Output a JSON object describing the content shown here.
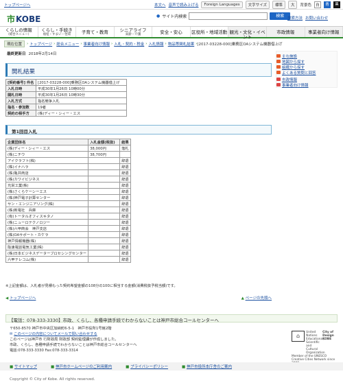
{
  "topbar": {
    "back": "トップページへ",
    "text_size": "本文へ",
    "voice": "音声で読み上げる",
    "foreign": "Foreign Languages",
    "fontsize": "文字サイズ",
    "standard": "標準",
    "large": "大",
    "bg": "背景色",
    "c1": "白",
    "c2": "青",
    "c3": "黒"
  },
  "header": {
    "logo": "KOBE",
    "search_label": "サイト内検索",
    "search_btn": "検索",
    "search_help": "検索方法",
    "inquiry": "お問い合わせ"
  },
  "nav": [
    {
      "label": "くらしの情報",
      "sub": "(総合メニュー)"
    },
    {
      "label": "くらし・手続き",
      "sub": "福祉・すまい・住環"
    },
    {
      "label": "子育て・教育",
      "sub": ""
    },
    {
      "label": "シニアライフ",
      "sub": "高齢・介護"
    },
    {
      "label": "安全・安心",
      "sub": ""
    },
    {
      "label": "区役所・地域活動",
      "sub": ""
    },
    {
      "label": "観光・文化・イベント",
      "sub": ""
    },
    {
      "label": "市政情報",
      "sub": ""
    },
    {
      "label": "事業者向け情報",
      "sub": ""
    }
  ],
  "crumb": {
    "current": "現在位置",
    "items": [
      "トップページ",
      "総合メニュー",
      "事業者向け情報",
      "入札・契約・税金",
      "入札情報",
      "物品等関札結果"
    ],
    "tail": "[2017-03228-000]乗務区OAシステム機器借上げ"
  },
  "updated": {
    "label": "最終更新日",
    "date": "2018年2月14日"
  },
  "side": [
    {
      "label": "主な施設",
      "icon": "facility-icon"
    },
    {
      "label": "地図から探す",
      "icon": "map-icon"
    },
    {
      "label": "組織から探す",
      "icon": "org-icon"
    },
    {
      "label": "よくある質問と回答",
      "icon": "faq-icon"
    },
    {
      "label": "市政情報",
      "icon": "city-icon"
    },
    {
      "label": "事業者向け情報",
      "icon": "business-icon"
    }
  ],
  "title": "開札結果",
  "info": [
    {
      "k": "[契約番号] 件名",
      "v": "[2017-03228-000]乗務区OAシステム機器借上げ"
    },
    {
      "k": "入札日時",
      "v": "平成30年1月26日 10時00分"
    },
    {
      "k": "開札日時",
      "v": "平成30年1月26日 10時30分"
    },
    {
      "k": "入札方式",
      "v": "指名競争入札"
    },
    {
      "k": "指名・参加数",
      "v": "19者"
    },
    {
      "k": "契約の相手方",
      "v": "(株)ディー・シィー・エス"
    }
  ],
  "round_title": "第1回目入札",
  "bids_head": {
    "name": "企業団体名",
    "price": "入札金額(税抜)",
    "result": "結果"
  },
  "bids": [
    {
      "name": "(株)ディー・シィー・エス",
      "price": "38,000円",
      "result": "落札"
    },
    {
      "name": "(株)ニチウ",
      "price": "38,700円",
      "result": ""
    },
    {
      "name": "アイクラフト(株)",
      "price": "",
      "result": "辞退"
    },
    {
      "name": "(株)イナハラ",
      "price": "",
      "result": "辞退"
    },
    {
      "name": "(株)亀井商店",
      "price": "",
      "result": "辞退"
    },
    {
      "name": "(株)カワイビジネス",
      "price": "",
      "result": "辞退"
    },
    {
      "name": "光栄工業(株)",
      "price": "",
      "result": "辞退"
    },
    {
      "name": "(株)さくらケーシーエス",
      "price": "",
      "result": "辞退"
    },
    {
      "name": "(株)神戸電子計算センター",
      "price": "",
      "result": "辞退"
    },
    {
      "name": "サン・エンジニアリング(株)",
      "price": "",
      "result": "辞退"
    },
    {
      "name": "(株)新電社　兵庫",
      "price": "",
      "result": "辞退"
    },
    {
      "name": "(有)トータルオフィスキタノ",
      "price": "",
      "result": "辞退"
    },
    {
      "name": "(株)ニューロテクノロジー",
      "price": "",
      "result": "辞退"
    },
    {
      "name": "(株)六甲商会　神戸支店",
      "price": "",
      "result": "辞退"
    },
    {
      "name": "(株)OAサポート・カケラ",
      "price": "",
      "result": "辞退"
    },
    {
      "name": "神戸情報機器(株)",
      "price": "",
      "result": "辞退"
    },
    {
      "name": "阪速電話電気工業(株)",
      "price": "",
      "result": "辞退"
    },
    {
      "name": "(株)日本ビジネスデーターブロセシングセンター",
      "price": "",
      "result": "辞退"
    },
    {
      "name": "六甲テレコム(株)",
      "price": "",
      "result": "辞退"
    }
  ],
  "note": "※上記金額は、入札者が見積もった契約希望金額の108分の100に相当する金額(消費税抜予税当額)です。",
  "pager": {
    "back": "トップページへ",
    "top": "ページの先頭へ"
  },
  "footer": {
    "call": "【電話：078-333-3330】市政、くらし、各種申請手続でわからないことは神戸市総合コールセンターへ",
    "addr1": "〒650-8570 神戸市中央区加納町6-5-1　神戸市役所1号館2階",
    "addr2": "このページの内容についてメールで問い合わせする",
    "addr3": "このページは神戸市 行財政局 財政部 契約監理課が作成しました。",
    "addr4": "市政、くらし、各種申請手続でわからないことは神戸市総合コールセンターへ",
    "addr5": "電話:078-333-3330 Fax:078-333-3314",
    "unesco_l": "United Nations Educational, Scientific and Cultural Organization",
    "unesco_r": "Member of the UNESCO Creative Cities Network since 2008",
    "city_design": "City of Design KOBE",
    "links": [
      "サイトマップ",
      "神戸市ホームページのご利用案内",
      "プライバシーポリシー",
      "神戸市役所本庁舎のご案内"
    ],
    "copyright": "Copyright © City of Kobe. All rights reserved."
  }
}
